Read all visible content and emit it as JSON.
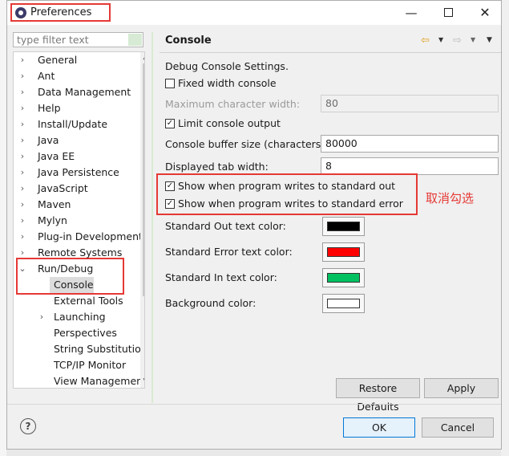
{
  "window": {
    "title": "Preferences",
    "minimize_icon": "minimize-icon",
    "maximize_icon": "maximize-icon",
    "close_icon": "close-icon"
  },
  "filter": {
    "placeholder": "type filter text"
  },
  "tree": {
    "items": [
      {
        "label": "General",
        "expandable": true
      },
      {
        "label": "Ant",
        "expandable": true
      },
      {
        "label": "Data Management",
        "expandable": true
      },
      {
        "label": "Help",
        "expandable": true
      },
      {
        "label": "Install/Update",
        "expandable": true
      },
      {
        "label": "Java",
        "expandable": true
      },
      {
        "label": "Java EE",
        "expandable": true
      },
      {
        "label": "Java Persistence",
        "expandable": true
      },
      {
        "label": "JavaScript",
        "expandable": true
      },
      {
        "label": "Maven",
        "expandable": true
      },
      {
        "label": "Mylyn",
        "expandable": true
      },
      {
        "label": "Plug-in Development",
        "expandable": true
      },
      {
        "label": "Remote Systems",
        "expandable": true
      },
      {
        "label": "Run/Debug",
        "expanded": true
      },
      {
        "label": "Console",
        "selected": true
      },
      {
        "label": "External Tools"
      },
      {
        "label": "Launching",
        "expandable": true
      },
      {
        "label": "Perspectives"
      },
      {
        "label": "String Substitution"
      },
      {
        "label": "TCP/IP Monitor"
      },
      {
        "label": "View Management"
      }
    ]
  },
  "panel": {
    "title": "Console",
    "section_label": "Debug Console Settings.",
    "fixed_width": {
      "label": "Fixed width console",
      "checked": false
    },
    "max_char_width": {
      "label": "Maximum character width:",
      "value": "80"
    },
    "limit_output": {
      "label": "Limit console output",
      "checked": true
    },
    "buffer_size": {
      "label": "Console buffer size (characters):",
      "value": "80000"
    },
    "tab_width": {
      "label": "Displayed tab width:",
      "value": "8"
    },
    "show_stdout": {
      "label": "Show when program writes to standard out",
      "checked": true
    },
    "show_stderr": {
      "label": "Show when program writes to standard error",
      "checked": true
    },
    "colors": [
      {
        "label": "Standard Out text color:",
        "color": "#000000"
      },
      {
        "label": "Standard Error text color:",
        "color": "#ff0000"
      },
      {
        "label": "Standard In text color:",
        "color": "#00c060"
      },
      {
        "label": "Background color:",
        "color": "#ffffff"
      }
    ],
    "annotation": "取消勾选"
  },
  "buttons": {
    "restore_defaults": "Restore Defaults",
    "apply": "Apply",
    "ok": "OK",
    "cancel": "Cancel"
  },
  "theme": {
    "highlight": "#e53935",
    "focus": "#0078d7"
  }
}
